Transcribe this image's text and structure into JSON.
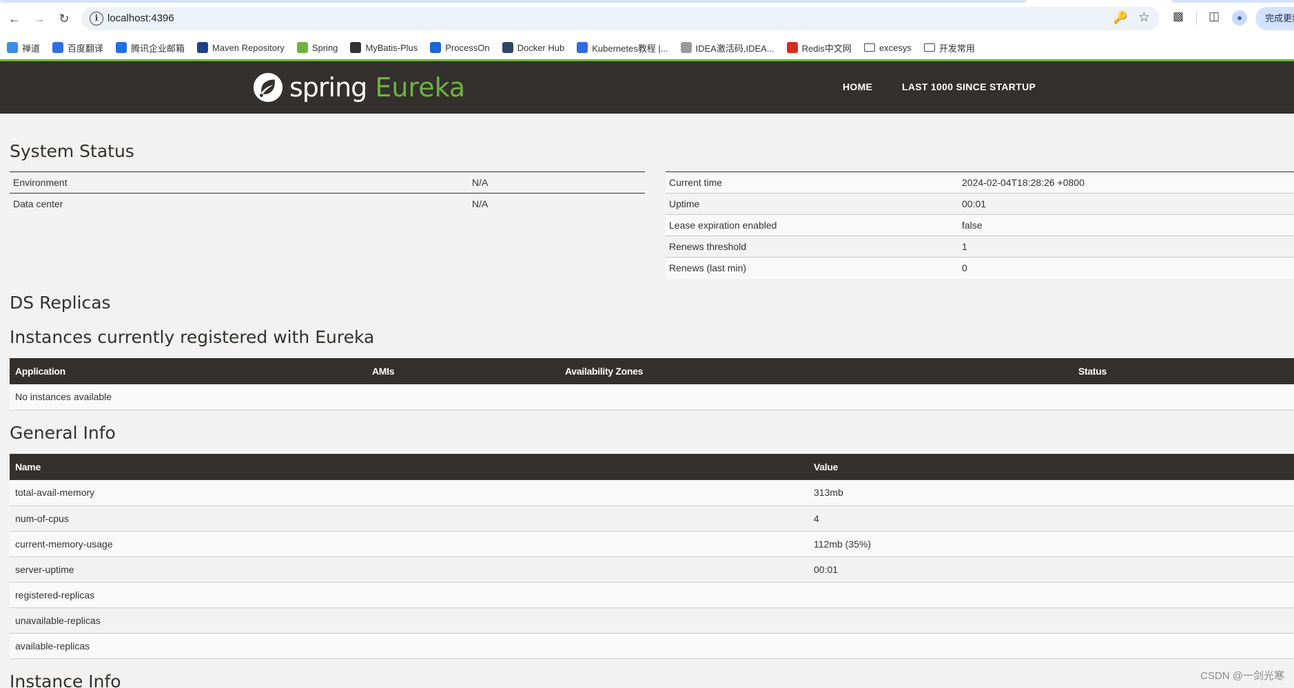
{
  "browser": {
    "url": "localhost:4396",
    "update_label": "完成更新"
  },
  "bookmarks": [
    {
      "label": "禅道",
      "icon": "zentao-icon",
      "color": "#3a8ee6"
    },
    {
      "label": "百度翻译",
      "icon": "baidu-translate-icon",
      "color": "#2f6fe4"
    },
    {
      "label": "腾讯企业邮箱",
      "icon": "tencent-mail-icon",
      "color": "#1f6fe8"
    },
    {
      "label": "Maven Repository",
      "icon": "maven-icon",
      "color": "#1d3f8c"
    },
    {
      "label": "Spring",
      "icon": "spring-icon",
      "color": "#6db33f"
    },
    {
      "label": "MyBatis-Plus",
      "icon": "mybatis-icon",
      "color": "#333333"
    },
    {
      "label": "ProcessOn",
      "icon": "processon-icon",
      "color": "#1a66d2"
    },
    {
      "label": "Docker Hub",
      "icon": "docker-icon",
      "color": "#324567"
    },
    {
      "label": "Kubernetes教程 |...",
      "icon": "kubernetes-icon",
      "color": "#326ce5"
    },
    {
      "label": "IDEA激活码,IDEA...",
      "icon": "idea-icon",
      "color": "#999999"
    },
    {
      "label": "Redis中文网",
      "icon": "redis-icon",
      "color": "#d82c20"
    },
    {
      "label": "excesys",
      "icon": "folder-icon",
      "color": "#444444"
    },
    {
      "label": "开发常用",
      "icon": "folder-icon",
      "color": "#444444"
    }
  ],
  "header": {
    "brand_spring": "spring",
    "brand_eureka": "Eureka",
    "nav_home": "HOME",
    "nav_last": "LAST 1000 SINCE STARTUP"
  },
  "system_status": {
    "title": "System Status",
    "left": [
      {
        "key": "Environment",
        "value": "N/A"
      },
      {
        "key": "Data center",
        "value": "N/A"
      }
    ],
    "right": [
      {
        "key": "Current time",
        "value": "2024-02-04T18:28:26 +0800"
      },
      {
        "key": "Uptime",
        "value": "00:01"
      },
      {
        "key": "Lease expiration enabled",
        "value": "false"
      },
      {
        "key": "Renews threshold",
        "value": "1"
      },
      {
        "key": "Renews (last min)",
        "value": "0"
      }
    ]
  },
  "ds_replicas": {
    "title": "DS Replicas"
  },
  "instances": {
    "title": "Instances currently registered with Eureka",
    "headers": [
      "Application",
      "AMIs",
      "Availability Zones",
      "Status"
    ],
    "empty_text": "No instances available"
  },
  "general_info": {
    "title": "General Info",
    "headers": [
      "Name",
      "Value"
    ],
    "rows": [
      {
        "name": "total-avail-memory",
        "value": "313mb"
      },
      {
        "name": "num-of-cpus",
        "value": "4"
      },
      {
        "name": "current-memory-usage",
        "value": "112mb (35%)"
      },
      {
        "name": "server-uptime",
        "value": "00:01"
      },
      {
        "name": "registered-replicas",
        "value": ""
      },
      {
        "name": "unavailable-replicas",
        "value": ""
      },
      {
        "name": "available-replicas",
        "value": ""
      }
    ]
  },
  "instance_info": {
    "title": "Instance Info"
  },
  "watermark": "CSDN @一剑光寒"
}
